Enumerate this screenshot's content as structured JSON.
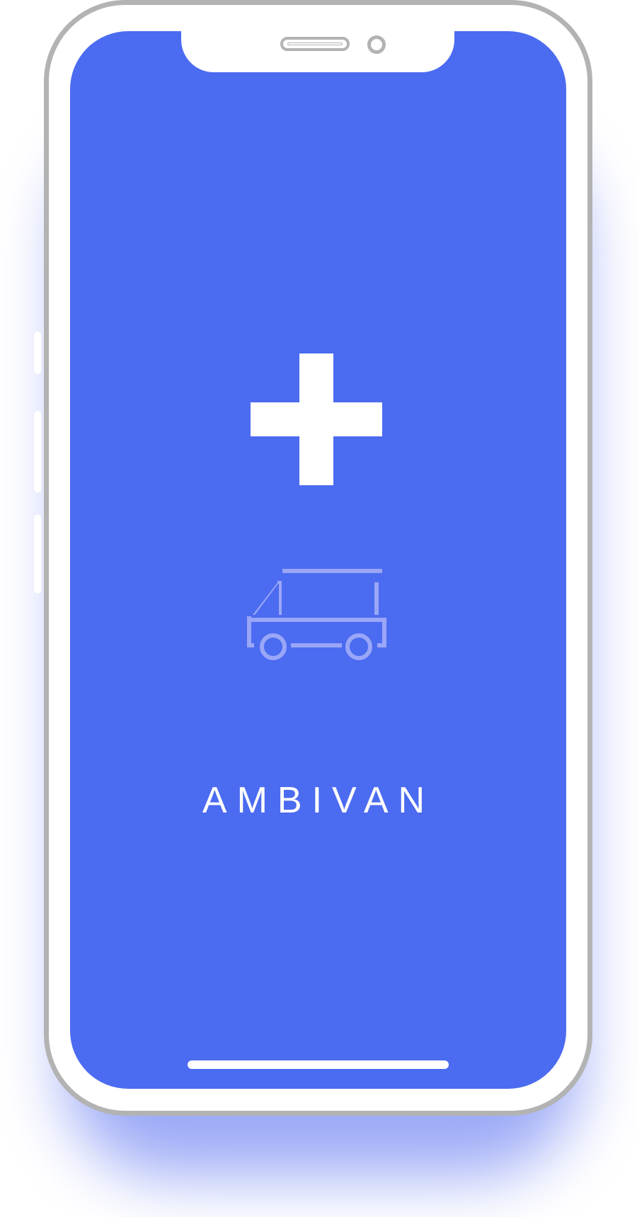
{
  "app": {
    "brand_name": "AMBIVAN"
  },
  "screen": {
    "background_color": "#4b6bf0",
    "foreground_color": "#ffffff",
    "icon_tint": "#9aa6f7"
  },
  "icons": {
    "plus": "medical-cross-icon",
    "vehicle": "ambulance-van-icon"
  }
}
